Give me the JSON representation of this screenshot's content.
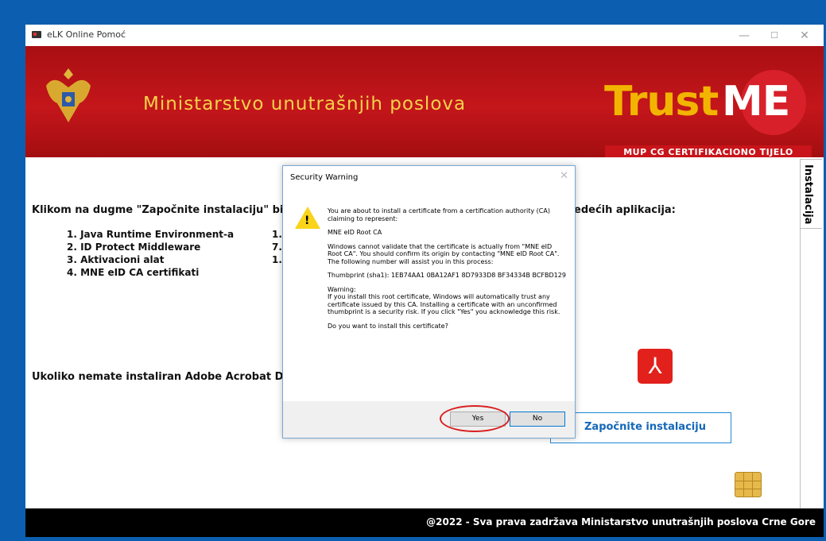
{
  "window": {
    "title": "eLK Online Pomoć"
  },
  "window_controls": {
    "minimize": "—",
    "maximize": "☐",
    "close": "✕"
  },
  "banner": {
    "ministry": "Ministarstvo unutrašnjih poslova",
    "brand_trust": "Trust",
    "brand_me": "ME",
    "brand_sub": "MUP CG CERTIFIKACIONO TIJELO"
  },
  "tab": {
    "label": "Instalacija"
  },
  "content": {
    "intro_left": "Klikom na dugme \"Započnite instalaciju\" biće",
    "intro_right": "edećih aplikacija:",
    "items": [
      "1. Java Runtime Environment-a",
      "2. ID Protect Middleware",
      "3. Aktivacioni alat",
      "4. MNE eID CA certifikati"
    ],
    "col2": [
      "1.",
      "7.",
      "1."
    ],
    "adobe_line": "Ukoliko nemate instaliran Adobe Acrobat DC",
    "pdf_icon": "⅄",
    "start_button": "Započnite instalaciju"
  },
  "footer": {
    "text": "@2022 - Sva prava zadržava Ministarstvo unutrašnjih poslova Crne Gore"
  },
  "dialog": {
    "title": "Security Warning",
    "close": "✕",
    "warn_symbol": "!",
    "paragraphs": [
      "You are about to install a certificate from a certification authority (CA) claiming to represent:",
      "MNE eID Root CA",
      "Windows cannot validate that the certificate is actually from \"MNE eID Root CA\". You should confirm its origin by contacting \"MNE eID Root CA\". The following number will assist you in this process:",
      "Thumbprint (sha1): 1EB74AA1 0BA12AF1 8D7933D8 BF34334B BCFBD129",
      "Warning:\nIf you install this root certificate, Windows will automatically trust any certificate issued by this CA. Installing a certificate with an unconfirmed thumbprint is a security risk. If you click \"Yes\" you acknowledge this risk.",
      "Do you want to install this certificate?"
    ],
    "yes": "Yes",
    "no": "No"
  }
}
